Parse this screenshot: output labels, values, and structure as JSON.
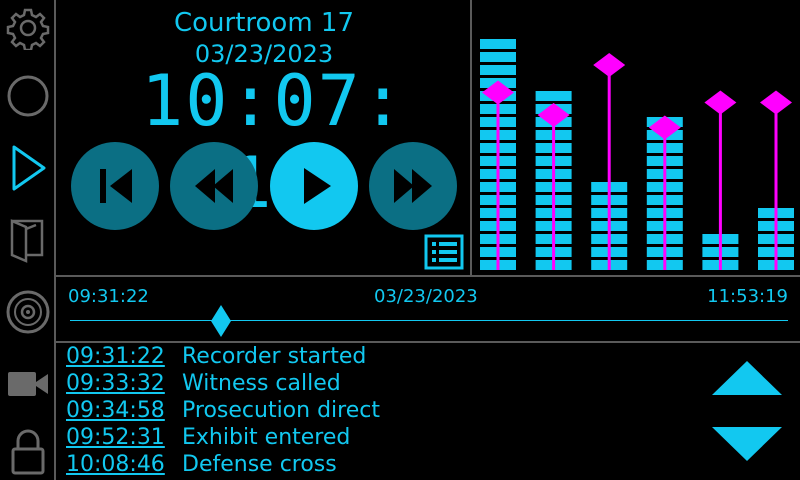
{
  "header": {
    "courtroom": "Courtroom 17",
    "date": "03/23/2023",
    "clock": "10:07: 19"
  },
  "sidebar": {
    "items": [
      {
        "icon": "gear-icon"
      },
      {
        "icon": "circle-record-icon"
      },
      {
        "icon": "play-outline-icon",
        "active": true
      },
      {
        "icon": "folder-icon"
      },
      {
        "icon": "disc-icon"
      },
      {
        "icon": "video-camera-icon"
      },
      {
        "icon": "lock-icon"
      }
    ]
  },
  "controls": [
    "skip-previous",
    "rewind",
    "play",
    "fast-forward"
  ],
  "meters": {
    "levels": [
      0.94,
      0.74,
      0.34,
      0.64,
      0.14,
      0.24
    ],
    "peaks": [
      0.71,
      0.62,
      0.82,
      0.57,
      0.67,
      0.67
    ]
  },
  "timeline": {
    "start": "09:31:22",
    "date": "03/23/2023",
    "end": "11:53:19",
    "position": 0.21
  },
  "events": [
    {
      "time": "09:31:22",
      "text": "Recorder started"
    },
    {
      "time": "09:33:32",
      "text": "Witness called"
    },
    {
      "time": "09:34:58",
      "text": "Prosecution direct"
    },
    {
      "time": "09:52:31",
      "text": "Exhibit entered"
    },
    {
      "time": "10:08:46",
      "text": "Defense cross"
    }
  ],
  "colors": {
    "accent": "#12c8f0",
    "dark_accent": "#0b6f84",
    "peak": "#ff00ff",
    "border": "#5a5a5a"
  }
}
